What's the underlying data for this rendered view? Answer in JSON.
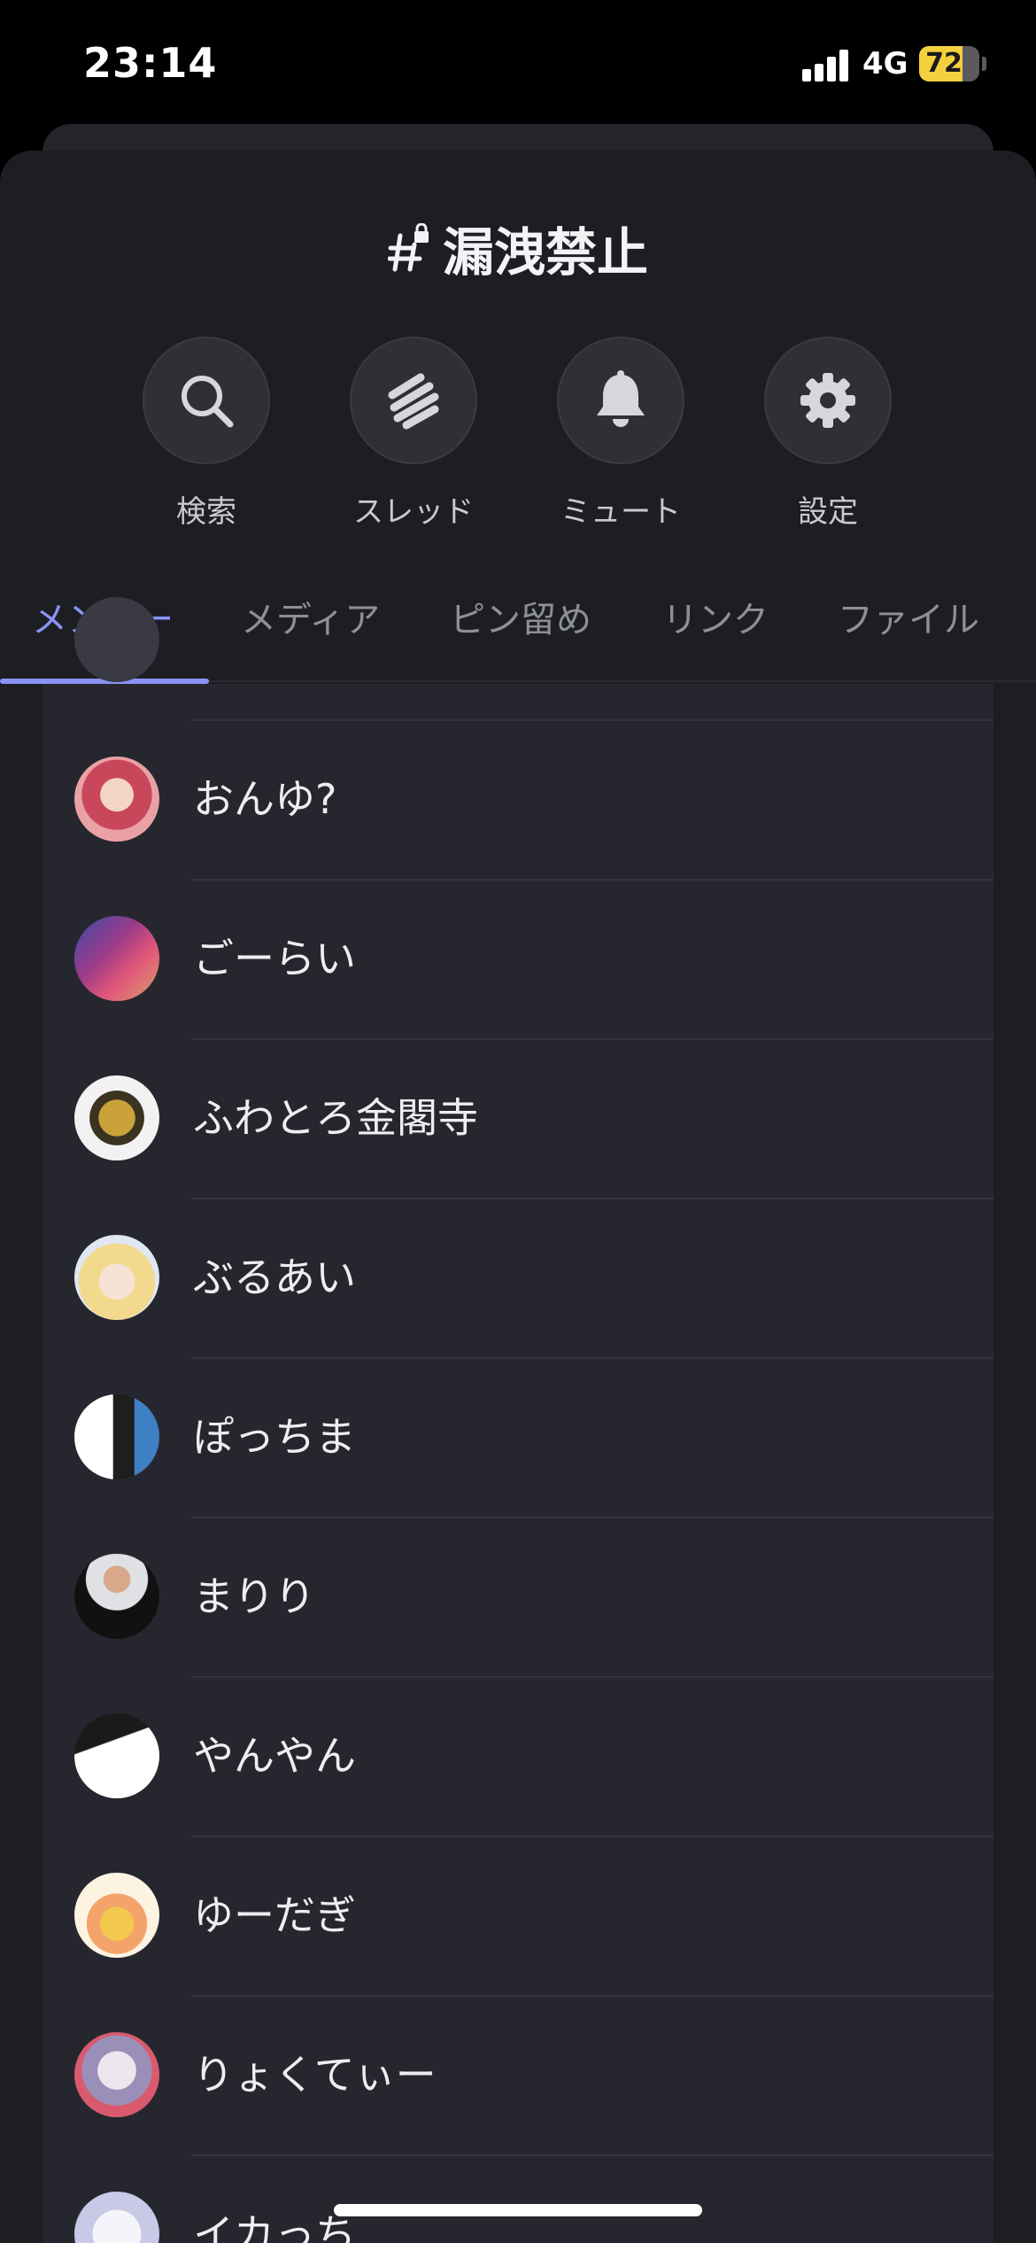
{
  "status_bar": {
    "time": "23:14",
    "network": "4G",
    "battery": "72",
    "battery_level": 0.72
  },
  "channel": {
    "name": "漏洩禁止",
    "icon": "locked-hashtag-icon"
  },
  "actions": [
    {
      "label": "検索",
      "icon": "search-icon"
    },
    {
      "label": "スレッド",
      "icon": "threads-icon"
    },
    {
      "label": "ミュート",
      "icon": "bell-icon"
    },
    {
      "label": "設定",
      "icon": "gear-icon"
    }
  ],
  "tabs": [
    {
      "label": "メンバー",
      "active": true
    },
    {
      "label": "メディア",
      "active": false
    },
    {
      "label": "ピン留め",
      "active": false
    },
    {
      "label": "リンク",
      "active": false
    },
    {
      "label": "ファイル",
      "active": false
    }
  ],
  "members": [
    {
      "name": "おんゆ?"
    },
    {
      "name": "ごーらい"
    },
    {
      "name": "ふわとろ金閣寺"
    },
    {
      "name": "ぶるあい"
    },
    {
      "name": "ぽっちま"
    },
    {
      "name": "まりり"
    },
    {
      "name": "やんやん"
    },
    {
      "name": "ゆーだぎ"
    },
    {
      "name": "りょくてぃー"
    },
    {
      "name": "イカっち"
    }
  ],
  "colors": {
    "accent": "#8a93f5",
    "sheet_background": "#1d1e23",
    "list_background": "#26272e",
    "battery": "#f4d03f"
  }
}
